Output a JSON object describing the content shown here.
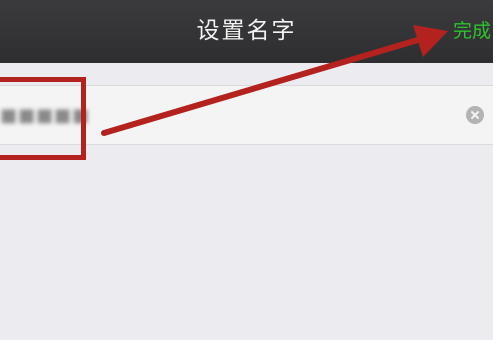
{
  "nav": {
    "title": "设置名字",
    "done_label": "完成"
  },
  "name_field": {
    "value": "■■■■■",
    "clear_icon": "clear-circle-icon"
  },
  "annotation": {
    "color": "#b3221f"
  },
  "colors": {
    "nav_background": "#2e2e30",
    "accent_green": "#2ec22e",
    "page_background": "#ebebf0"
  }
}
